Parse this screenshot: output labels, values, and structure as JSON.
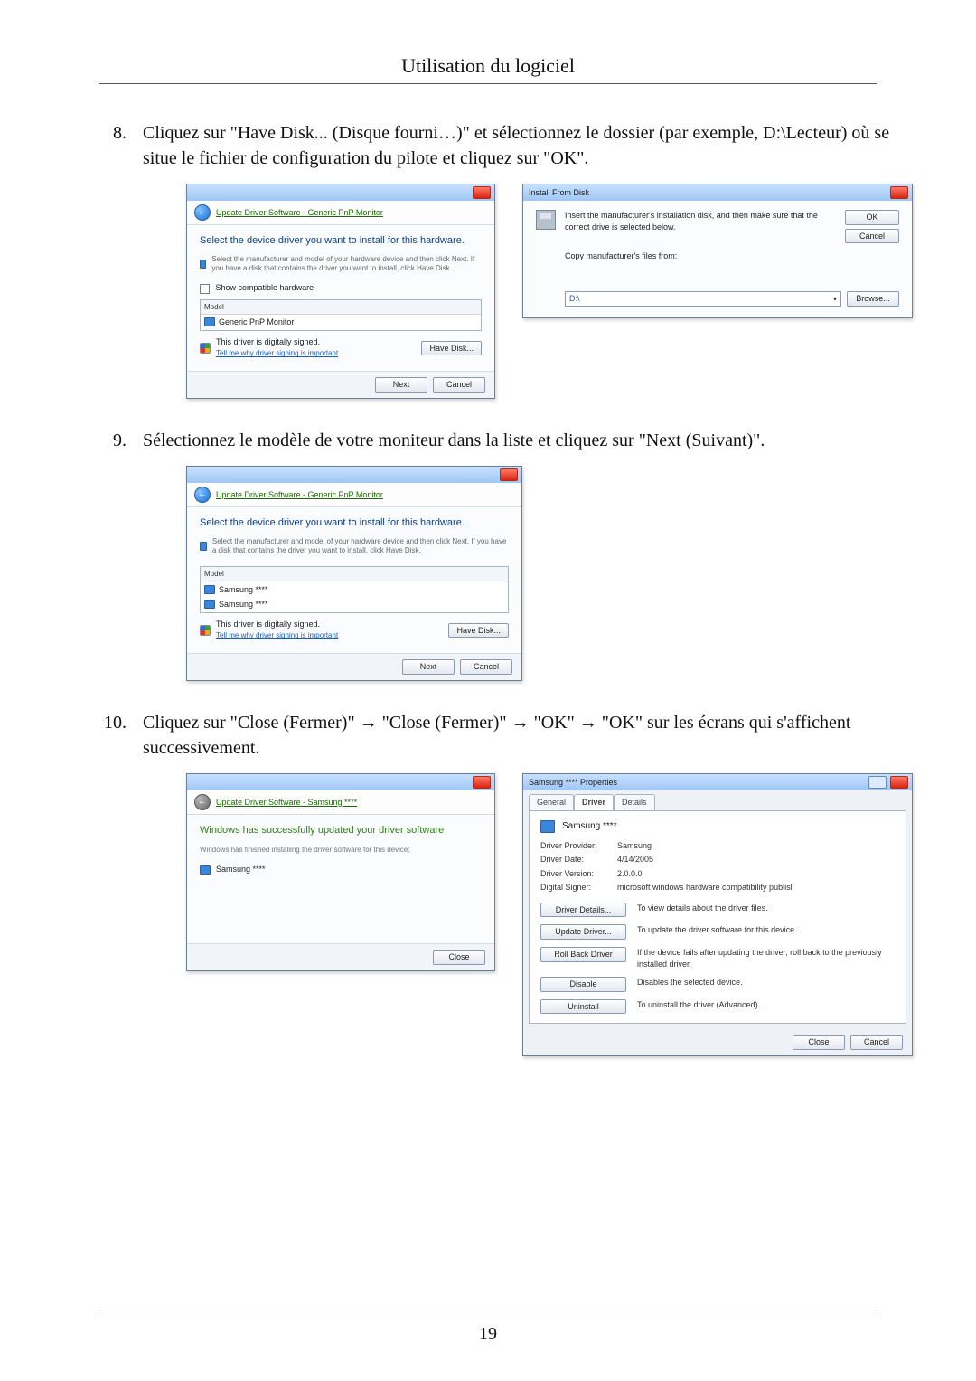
{
  "page": {
    "section_title": "Utilisation du logiciel",
    "number": "19"
  },
  "steps": {
    "s8": {
      "num": "8.",
      "text": "Cliquez sur \"Have Disk... (Disque fourni…)\" et sélectionnez le dossier (par exemple, D:\\Lecteur) où se situe le fichier de configuration du pilote et cliquez sur \"OK\"."
    },
    "s9": {
      "num": "9.",
      "text": "Sélectionnez le modèle de votre moniteur dans la liste et cliquez sur \"Next (Suivant)\"."
    },
    "s10": {
      "num": "10.",
      "text": "Cliquez sur \"Close (Fermer)\" → \"Close (Fermer)\" → \"OK\" → \"OK\" sur les écrans qui s'affichent successivement."
    }
  },
  "wizard_generic": {
    "breadcrumb": "Update Driver Software - Generic PnP Monitor",
    "heading": "Select the device driver you want to install for this hardware.",
    "note": "Select the manufacturer and model of your hardware device and then click Next. If you have a disk that contains the driver you want to install, click Have Disk.",
    "show_compat": "Show compatible hardware",
    "model_label": "Model",
    "model_item": "Generic PnP Monitor",
    "signed": "This driver is digitally signed.",
    "tell_me": "Tell me why driver signing is important",
    "have_disk": "Have Disk...",
    "next": "Next",
    "cancel": "Cancel"
  },
  "install_from_disk": {
    "title": "Install From Disk",
    "msg": "Insert the manufacturer's installation disk, and then make sure that the correct drive is selected below.",
    "ok": "OK",
    "cancel": "Cancel",
    "copy_label": "Copy manufacturer's files from:",
    "path": "D:\\",
    "browse": "Browse..."
  },
  "wizard_samsung": {
    "breadcrumb": "Update Driver Software - Generic PnP Monitor",
    "heading": "Select the device driver you want to install for this hardware.",
    "note": "Select the manufacturer and model of your hardware device and then click Next. If you have a disk that contains the driver you want to install, click Have Disk.",
    "model_label": "Model",
    "item1": "Samsung ****",
    "item2": "Samsung ****",
    "signed": "This driver is digitally signed.",
    "tell_me": "Tell me why driver signing is important",
    "have_disk": "Have Disk...",
    "next": "Next",
    "cancel": "Cancel"
  },
  "success": {
    "breadcrumb": "Update Driver Software - Samsung ****",
    "heading": "Windows has successfully updated your driver software",
    "sub": "Windows has finished installing the driver software for this device:",
    "device": "Samsung ****",
    "close": "Close"
  },
  "props": {
    "title": "Samsung **** Properties",
    "tab_general": "General",
    "tab_driver": "Driver",
    "tab_details": "Details",
    "device": "Samsung ****",
    "k_provider": "Driver Provider:",
    "v_provider": "Samsung",
    "k_date": "Driver Date:",
    "v_date": "4/14/2005",
    "k_version": "Driver Version:",
    "v_version": "2.0.0.0",
    "k_signer": "Digital Signer:",
    "v_signer": "microsoft windows hardware compatibility publisl",
    "btn_details": "Driver Details...",
    "d_details": "To view details about the driver files.",
    "btn_update": "Update Driver...",
    "d_update": "To update the driver software for this device.",
    "btn_rollback": "Roll Back Driver",
    "d_rollback": "If the device fails after updating the driver, roll back to the previously installed driver.",
    "btn_disable": "Disable",
    "d_disable": "Disables the selected device.",
    "btn_uninstall": "Uninstall",
    "d_uninstall": "To uninstall the driver (Advanced).",
    "close": "Close",
    "cancel": "Cancel"
  }
}
